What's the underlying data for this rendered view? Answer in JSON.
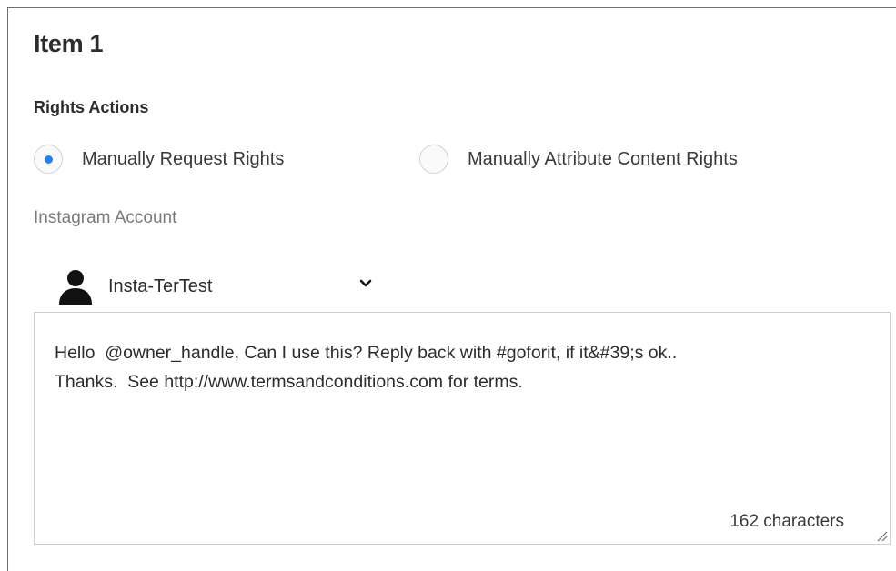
{
  "item": {
    "title": "Item 1"
  },
  "rights": {
    "heading": "Rights Actions",
    "options": [
      {
        "label": "Manually Request Rights",
        "selected": true
      },
      {
        "label": "Manually Attribute Content Rights",
        "selected": false
      }
    ]
  },
  "account": {
    "label": "Instagram Account",
    "selected": "Insta-TerTest",
    "icon": "user-silhouette-icon",
    "dropdown_icon": "chevron-down-icon"
  },
  "message": {
    "line1": "Hello  @owner_handle, Can I use this? Reply back with #goforit, if it&#39;s ok..",
    "line2": "Thanks.  See http://www.termsandconditions.com for terms.",
    "count": "162 characters"
  },
  "colors": {
    "accent": "#2680eb",
    "text": "#2c2c2c",
    "muted": "#7a7a7a",
    "border": "#cfcfcf"
  }
}
